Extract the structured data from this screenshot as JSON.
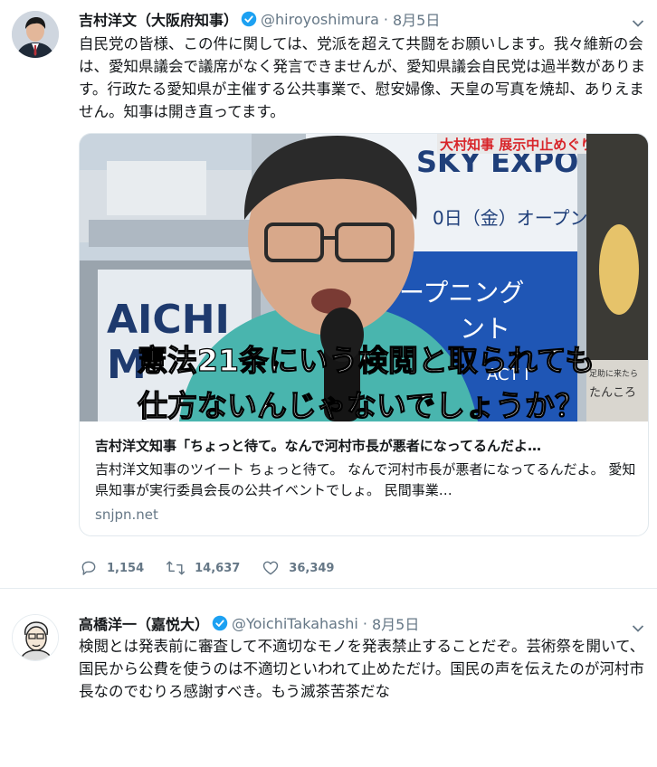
{
  "tweet1": {
    "name": "吉村洋文（大阪府知事）",
    "handle": "@hiroyoshimura",
    "dot": "·",
    "date": "8月5日",
    "text": "自民党の皆様、この件に関しては、党派を超えて共闘をお願いします。我々維新の会は、愛知県議会で議席がなく発言できませんが、愛知県議会自民党は過半数があります。行政たる愛知県が主催する公共事業で、慰安婦像、天皇の写真を焼却、ありえません。知事は開き直ってます。",
    "card": {
      "image_caption_line1": "憲法21条にいう検閲と取られても",
      "image_caption_line2": "仕方ないんじゃないでしょうか？",
      "image_banner": "大村知事 展示中止めぐり",
      "image_sign": "SKY EXPO",
      "image_sign_sub": "0日（金）オープン",
      "image_panel_text1": "オープニング",
      "image_panel_text2": "ント",
      "image_panel_text3": "ACT I",
      "image_left_sign": "AICHI",
      "image_left_sign2": "M",
      "image_right_small": "足助に来たら",
      "image_right_text": "たんころ",
      "title": "吉村洋文知事「ちょっと待て。なんで河村市長が悪者になってるんだよ…",
      "description": "吉村洋文知事のツイート ちょっと待て。 なんで河村市長が悪者になってるんだよ。 愛知県知事が実行委員会長の公共イベントでしょ。 民間事業…",
      "domain": "snjpn.net"
    },
    "actions": {
      "replies": "1,154",
      "retweets": "14,637",
      "likes": "36,349"
    }
  },
  "tweet2": {
    "name": "高橋洋一（嘉悦大）",
    "handle": "@YoichiTakahashi",
    "dot": "·",
    "date": "8月5日",
    "text": "検閲とは発表前に審査して不適切なモノを発表禁止することだぞ。芸術祭を開いて、国民から公費を使うのは不適切といわれて止めただけ。国民の声を伝えたのが河村市長なのでむりろ感謝すべき。もう滅茶苦茶だな"
  },
  "colors": {
    "verified": "#1da1f2",
    "secondary": "#657786",
    "border": "#e1e8ed"
  },
  "icons": [
    "verified-badge-icon",
    "caret-down-icon",
    "reply-icon",
    "retweet-icon",
    "like-icon"
  ]
}
